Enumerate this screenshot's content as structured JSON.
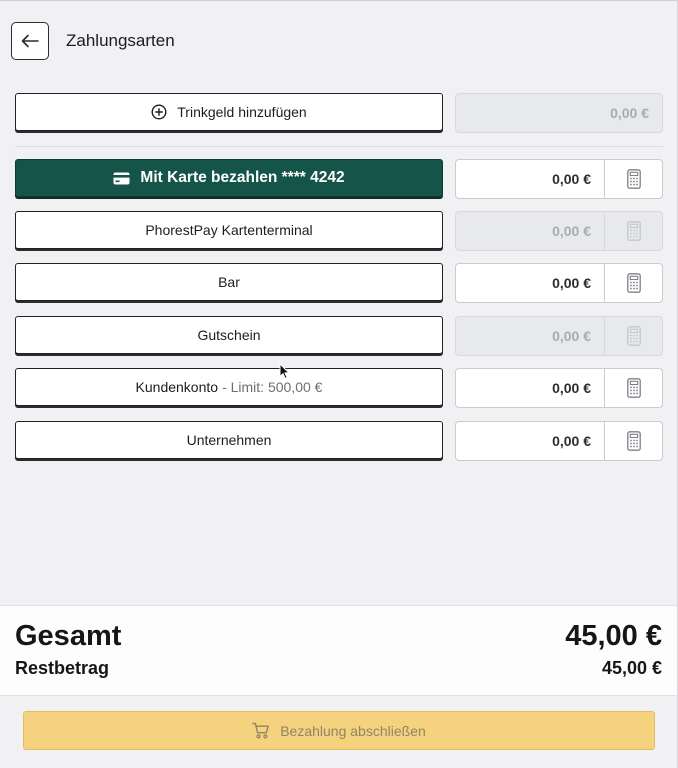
{
  "header": {
    "title": "Zahlungsarten"
  },
  "tip": {
    "label": "Trinkgeld hinzufügen",
    "amount": "0,00 €"
  },
  "payment_methods": [
    {
      "label": "Mit Karte bezahlen **** 4242",
      "amount": "0,00 €",
      "primary": true,
      "disabled": false
    },
    {
      "label": "PhorestPay Kartenterminal",
      "amount": "0,00 €",
      "primary": false,
      "disabled": true
    },
    {
      "label": "Bar",
      "amount": "0,00 €",
      "primary": false,
      "disabled": false
    },
    {
      "label": "Gutschein",
      "amount": "0,00 €",
      "primary": false,
      "disabled": true
    },
    {
      "label": "Kundenkonto",
      "limit_text": "- Limit: 500,00 €",
      "amount": "0,00 €",
      "primary": false,
      "disabled": false
    },
    {
      "label": "Unternehmen",
      "amount": "0,00 €",
      "primary": false,
      "disabled": false
    }
  ],
  "summary": {
    "total_label": "Gesamt",
    "total_value": "45,00 €",
    "rest_label": "Restbetrag",
    "rest_value": "45,00 €"
  },
  "footer": {
    "finish_label": "Bezahlung abschließen"
  },
  "icons": {
    "back": "arrow-left-icon",
    "tip": "plus-circle-icon",
    "card": "credit-card-icon",
    "calculator": "calculator-icon",
    "cart": "cart-icon"
  },
  "colors": {
    "primary": "#155449",
    "finish": "#f5d27e",
    "disabled": "#e8e9ec"
  }
}
